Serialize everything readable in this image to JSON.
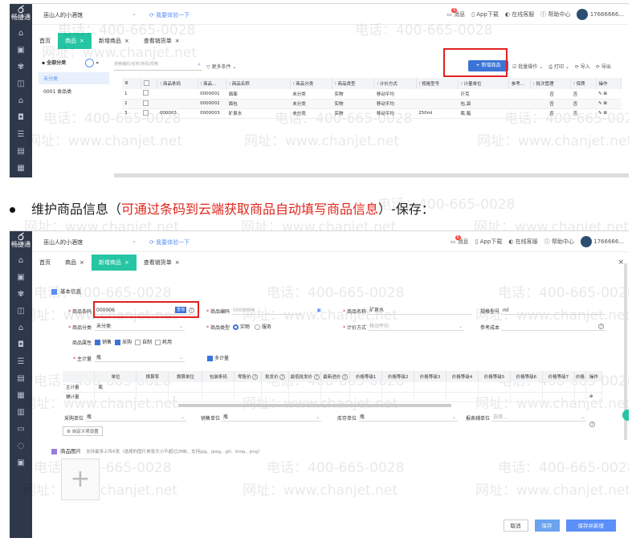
{
  "common": {
    "logo_text": "畅捷通",
    "logo_glyph": "ර",
    "shop_name": "巫山人的小酒馆",
    "switch_link": "我要体验一下",
    "messages": "消息",
    "message_count": "6",
    "app_download": "App下载",
    "online_service": "在线客服",
    "help_center": "帮助中心",
    "user_short": "17666666...",
    "user_short_2": "1766666...",
    "watermark_phone": "电话：400-665-0028",
    "watermark_site": "网址：www.chanjet.net"
  },
  "shot1": {
    "tabs": [
      {
        "label": "首页",
        "close": ""
      },
      {
        "label": "商品",
        "close": "×",
        "active": true
      },
      {
        "label": "新增商品",
        "close": "×"
      },
      {
        "label": "查看销货单",
        "close": "×"
      }
    ],
    "category_header": "全部分类",
    "categories": [
      "未分类",
      "0001 食品类"
    ],
    "search_placeholder": "搜索编码/名称/条码/规格",
    "more_conditions": "更多条件",
    "new_product": "+ 新增商品",
    "actions": [
      "批量操作",
      "打印",
      "导入",
      "导出"
    ],
    "columns": [
      "",
      "",
      "商品条码",
      "商品...",
      "商品名称",
      "商品分类",
      "商品类型",
      "计价方式",
      "规格型号",
      "计量单位",
      "参考...",
      "批次管理",
      "保质",
      "操作"
    ],
    "rows": [
      {
        "no": "1",
        "barcode": "",
        "code": "0000001",
        "name": "面面",
        "category": "未分类",
        "type": "实物",
        "pricing": "移动平均",
        "spec": "",
        "unit": "斤克",
        "batch": "否",
        "shelf": "否"
      },
      {
        "no": "2",
        "barcode": "",
        "code": "0000002",
        "name": "面包",
        "category": "未分类",
        "type": "实物",
        "pricing": "移动平均",
        "spec": "",
        "unit": "包,袋",
        "batch": "否",
        "shelf": "否"
      },
      {
        "no": "3",
        "barcode": "000003",
        "code": "0000003",
        "name": "矿泉水",
        "category": "未分类",
        "type": "实物",
        "pricing": "移动平均",
        "spec": "250ml",
        "unit": "瓶,箱",
        "batch": "否",
        "shelf": "否"
      }
    ]
  },
  "bullet": {
    "prefix": "维护商品信息（",
    "red": "可通过条码到云端获取商品自动填写商品信息",
    "suffix": "）-保存："
  },
  "shot2": {
    "tabs": [
      {
        "label": "首页",
        "close": ""
      },
      {
        "label": "商品",
        "close": "×"
      },
      {
        "label": "新增商品",
        "close": "×",
        "active": true
      },
      {
        "label": "查看销货单",
        "close": "×"
      }
    ],
    "basic_info": "基本信息",
    "barcode_label": "商品条码",
    "barcode_value": "000006",
    "barcode_btn": "查询",
    "code_label": "商品编码",
    "code_value": "0000004",
    "name_label": "商品名称",
    "name_value": "矿泉水",
    "spec_label": "规格型号",
    "spec_value": "ml",
    "category_label": "商品分类",
    "category_value": "未分类",
    "type_label": "商品类型",
    "type_options": [
      "实物",
      "服务"
    ],
    "pricing_label": "计价方式",
    "pricing_value": "移动平均",
    "ref_cost_label": "参考成本",
    "attr_label": "商品属性",
    "attrs": [
      "销售",
      "采购",
      "自制",
      "耗用"
    ],
    "main_unit_label": "主计量",
    "main_unit_value": "瓶",
    "multi_unit": "多计量",
    "unit_columns": [
      "",
      "单位",
      "换算率",
      "换算单位",
      "包装条码",
      "零售价",
      "批发价",
      "最低批发价",
      "最新进价",
      "价格等级1",
      "价格等级2",
      "价格等级3",
      "价格等级4",
      "价格等级5",
      "价格等级6",
      "价格等级7",
      "价格",
      "操作"
    ],
    "unit_rows": [
      {
        "type": "主计量",
        "unit": "瓶"
      },
      {
        "type": "辅计量",
        "unit": ""
      }
    ],
    "purchase_unit_label": "采购单位",
    "purchase_unit_value": "瓶",
    "sales_unit_label": "销售单位",
    "sales_unit_value": "瓶",
    "stock_unit_label": "库存单位",
    "stock_unit_value": "瓶",
    "report_unit_label": "报表辅单位",
    "report_unit_placeholder": "选择...",
    "custom_items": "自定义项设置",
    "images_label": "商品图片",
    "images_hint": "支持最多上传6张（选择的图片单张大小不超过2MB，支持jpg、jpeg、gif、bmp、png）",
    "cancel": "取消",
    "save": "保存",
    "save_new": "保存并新增"
  }
}
